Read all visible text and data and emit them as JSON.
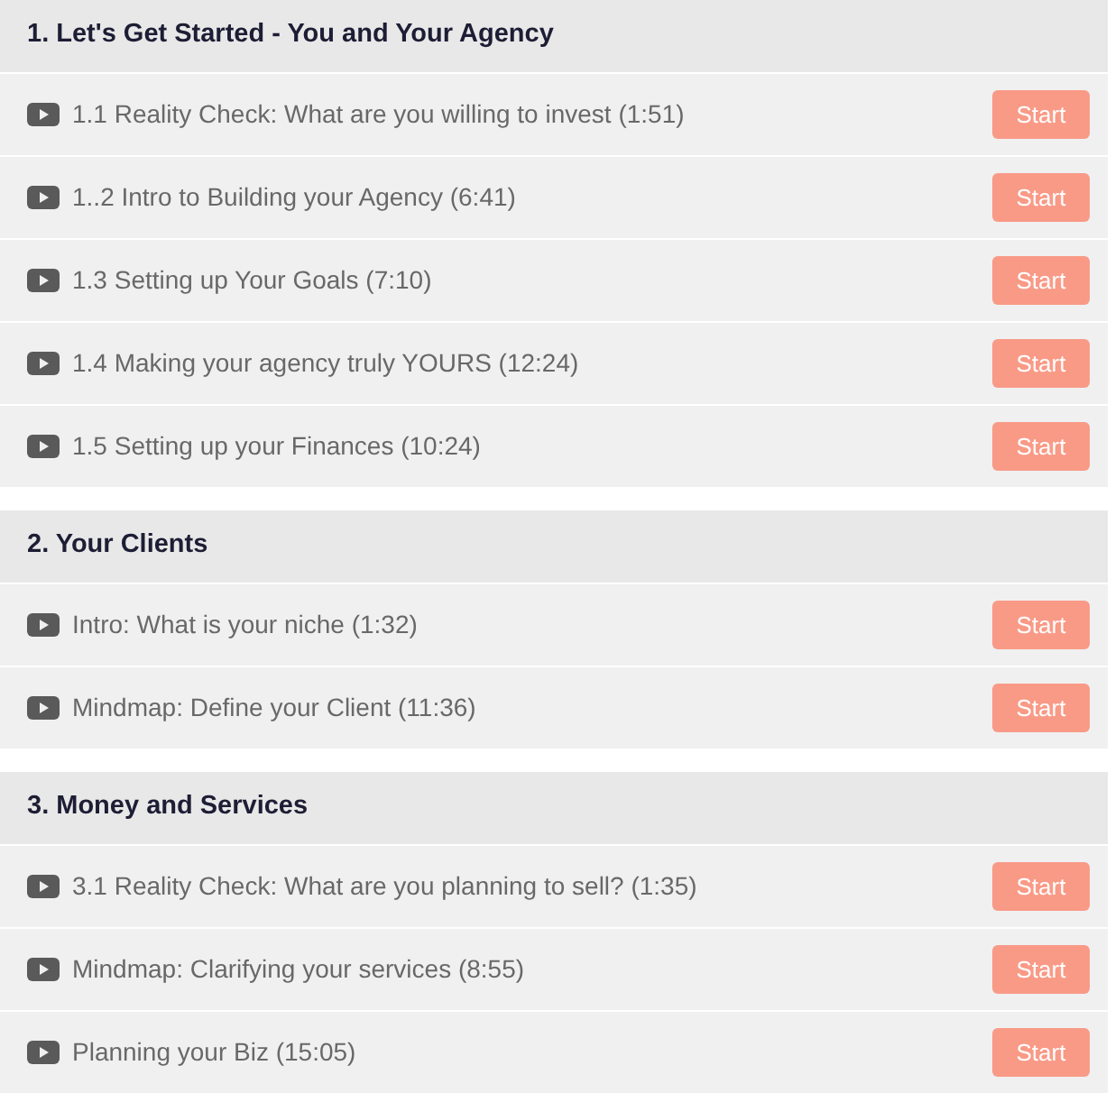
{
  "sections": [
    {
      "title": "1. Let's Get Started - You and Your Agency",
      "lessons": [
        {
          "title": "1.1 Reality Check: What are you willing to invest (1:51)",
          "button": "Start"
        },
        {
          "title": "1..2 Intro to Building your Agency (6:41)",
          "button": "Start"
        },
        {
          "title": "1.3 Setting up Your Goals (7:10)",
          "button": "Start"
        },
        {
          "title": "1.4 Making your agency truly YOURS (12:24)",
          "button": "Start"
        },
        {
          "title": "1.5 Setting up your Finances (10:24)",
          "button": "Start"
        }
      ]
    },
    {
      "title": "2. Your Clients",
      "lessons": [
        {
          "title": "Intro: What is your niche (1:32)",
          "button": "Start"
        },
        {
          "title": "Mindmap: Define your Client (11:36)",
          "button": "Start"
        }
      ]
    },
    {
      "title": "3. Money and Services",
      "lessons": [
        {
          "title": "3.1 Reality Check: What are you planning to sell? (1:35)",
          "button": "Start"
        },
        {
          "title": "Mindmap: Clarifying your services (8:55)",
          "button": "Start"
        },
        {
          "title": "Planning your Biz (15:05)",
          "button": "Start"
        }
      ]
    }
  ]
}
